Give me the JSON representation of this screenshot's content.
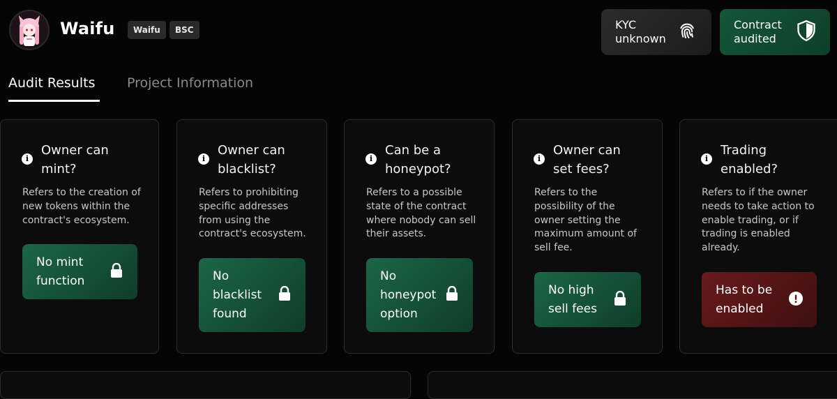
{
  "project": {
    "name": "Waifu",
    "tags": [
      "Waifu",
      "BSC"
    ]
  },
  "header_buttons": {
    "kyc": {
      "line1": "KYC",
      "line2": "unknown",
      "icon": "fingerprint-icon"
    },
    "contract": {
      "line1": "Contract",
      "line2": "audited",
      "icon": "shield-icon"
    }
  },
  "tabs": [
    {
      "label": "Audit Results",
      "active": true
    },
    {
      "label": "Project Information",
      "active": false
    }
  ],
  "cards": [
    {
      "q1": "Owner can",
      "q2": "mint?",
      "desc": [
        "Refers to the creation of",
        "new tokens within the",
        "contract's ecosystem."
      ],
      "result": [
        "No mint",
        "function"
      ],
      "status": "safe",
      "icon": "lock-icon"
    },
    {
      "q1": "Owner can",
      "q2": "blacklist?",
      "desc": [
        "Refers to prohibiting",
        "specific addresses",
        "from using the",
        "contract's ecosystem."
      ],
      "result": [
        "No",
        "blacklist",
        "found"
      ],
      "status": "safe",
      "icon": "lock-icon"
    },
    {
      "q1": "Can be a",
      "q2": "honeypot?",
      "desc": [
        "Refers to a possible",
        "state of the contract",
        "where nobody can sell",
        "their assets."
      ],
      "result": [
        "No",
        "honeypot",
        "option"
      ],
      "status": "safe",
      "icon": "lock-icon"
    },
    {
      "q1": "Owner can",
      "q2": "set fees?",
      "desc": [
        "Refers to the",
        "possibility of the",
        "owner setting the",
        "maximum amount of",
        "sell fee."
      ],
      "result": [
        "No high",
        "sell fees"
      ],
      "status": "safe",
      "icon": "lock-icon"
    },
    {
      "q1": "Trading",
      "q2": "enabled?",
      "desc": [
        "Refers to if the owner",
        "needs to take action to",
        "enable trading, or if",
        "trading is enabled",
        "already."
      ],
      "result": [
        "Has to be",
        "enabled"
      ],
      "status": "warning",
      "icon": "exclamation-icon"
    }
  ],
  "colors": {
    "background": "#050505",
    "safe": "#1c6647",
    "warning": "#6a1a1c",
    "card_border": "#2c2c2c"
  }
}
